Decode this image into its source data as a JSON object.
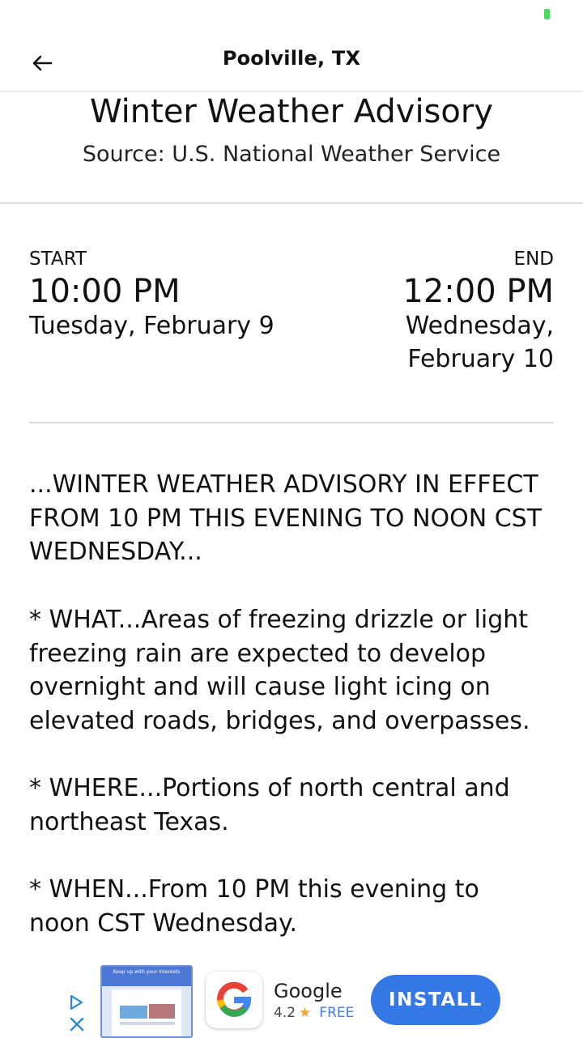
{
  "app_bar": {
    "title": "Poolville, TX",
    "back_icon": "arrow-left-icon"
  },
  "alert": {
    "title": "Winter Weather Advisory",
    "source": "Source: U.S. National Weather Service"
  },
  "start": {
    "label": "START",
    "time": "10:00 PM",
    "date": "Tuesday, February 9"
  },
  "end": {
    "label": "END",
    "time": "12:00 PM",
    "date": "Wednesday, February 10"
  },
  "body": {
    "paragraphs": [
      "...WINTER WEATHER ADVISORY IN EFFECT FROM 10 PM THIS EVENING TO NOON CST WEDNESDAY...",
      "* WHAT...Areas of freezing drizzle or light freezing rain are expected to develop overnight and will cause light icing on elevated roads, bridges, and overpasses.",
      "* WHERE...Portions of north central and northeast Texas.",
      "* WHEN...From 10 PM this evening to noon CST Wednesday."
    ]
  },
  "ad": {
    "screenshot_header": "Keep up with your interests",
    "app_name": "Google",
    "rating": "4.2",
    "rating_icon": "star-icon",
    "price": "FREE",
    "install_label": "INSTALL",
    "adchoices_icon": "adchoices-play-icon",
    "close_icon": "close-icon"
  },
  "colors": {
    "accent": "#3478e5",
    "battery": "#4cd964",
    "divider": "#dedede"
  }
}
